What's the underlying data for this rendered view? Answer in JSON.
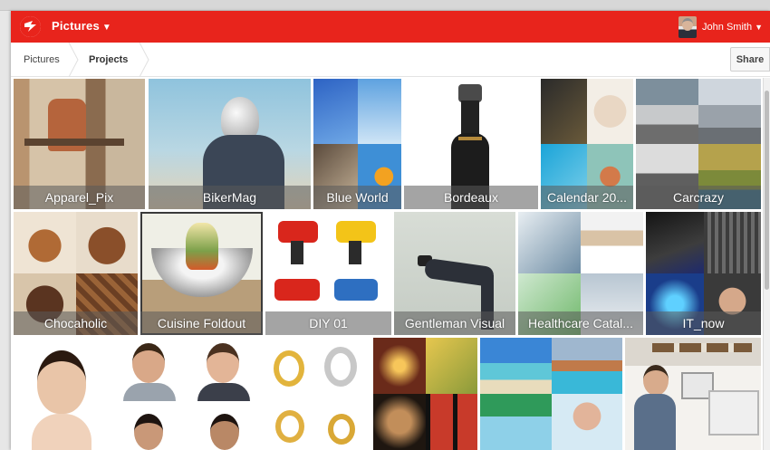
{
  "app": {
    "title": "Pictures",
    "user_name": "John Smith",
    "brand_color": "#e8241c"
  },
  "breadcrumb": {
    "items": [
      "Pictures",
      "Projects"
    ]
  },
  "toolbar": {
    "share_label": "Share"
  },
  "projects": [
    {
      "name": "Apparel_Pix"
    },
    {
      "name": "BikerMag"
    },
    {
      "name": "Blue World"
    },
    {
      "name": "Bordeaux"
    },
    {
      "name": "Calendar 20..."
    },
    {
      "name": "Carcrazy"
    },
    {
      "name": "Chocaholic"
    },
    {
      "name": "Cuisine Foldout",
      "selected": true
    },
    {
      "name": "DIY 01"
    },
    {
      "name": "Gentleman Visual"
    },
    {
      "name": "Healthcare Catal..."
    },
    {
      "name": "IT_now"
    }
  ],
  "icons": [
    "brand-logo-icon",
    "caret-down-icon",
    "breadcrumb-chevron-icon"
  ]
}
